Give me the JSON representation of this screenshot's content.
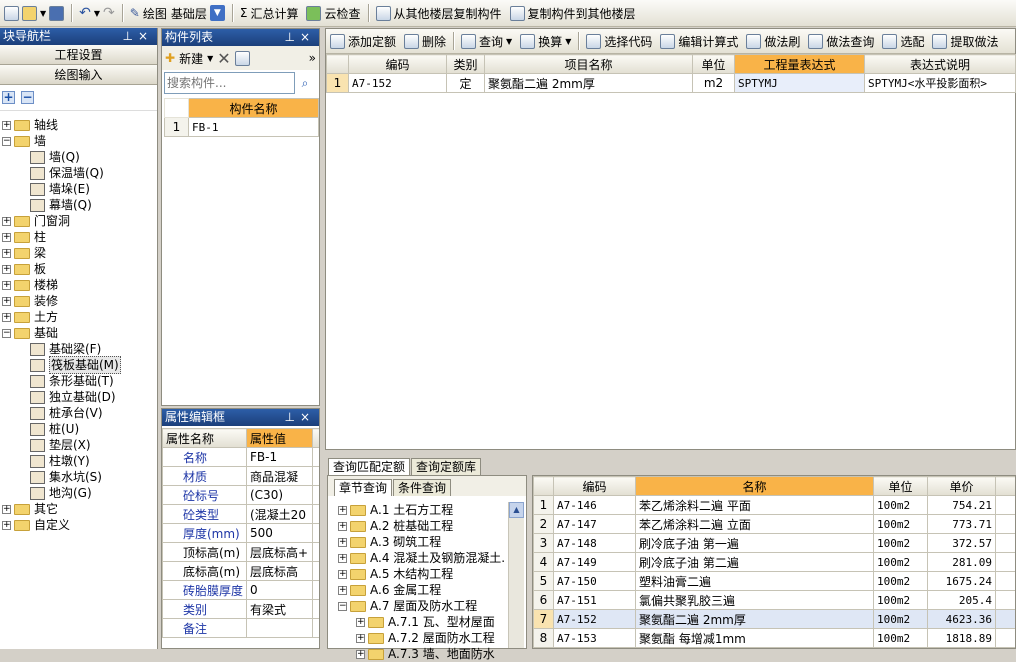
{
  "toolbar": {
    "items": [
      "绘图",
      "基础层",
      "汇总计算",
      "云检查",
      "从其他楼层复制构件",
      "复制构件到其他楼层"
    ]
  },
  "nav": {
    "title": "块导航栏",
    "btn1": "工程设置",
    "btn2": "绘图输入",
    "tree": [
      {
        "label": "轴线",
        "type": "folder",
        "level": 0,
        "pm": "+"
      },
      {
        "label": "墙",
        "type": "folder",
        "level": 0,
        "pm": "-"
      },
      {
        "label": "墙(Q)",
        "type": "item",
        "level": 1
      },
      {
        "label": "保温墙(Q)",
        "type": "item",
        "level": 1
      },
      {
        "label": "墙垛(E)",
        "type": "item",
        "level": 1
      },
      {
        "label": "幕墙(Q)",
        "type": "item",
        "level": 1
      },
      {
        "label": "门窗洞",
        "type": "folder",
        "level": 0,
        "pm": "+"
      },
      {
        "label": "柱",
        "type": "folder",
        "level": 0,
        "pm": "+"
      },
      {
        "label": "梁",
        "type": "folder",
        "level": 0,
        "pm": "+"
      },
      {
        "label": "板",
        "type": "folder",
        "level": 0,
        "pm": "+"
      },
      {
        "label": "楼梯",
        "type": "folder",
        "level": 0,
        "pm": "+"
      },
      {
        "label": "装修",
        "type": "folder",
        "level": 0,
        "pm": "+"
      },
      {
        "label": "土方",
        "type": "folder",
        "level": 0,
        "pm": "+"
      },
      {
        "label": "基础",
        "type": "folder",
        "level": 0,
        "pm": "-"
      },
      {
        "label": "基础梁(F)",
        "type": "item",
        "level": 1
      },
      {
        "label": "筏板基础(M)",
        "type": "item",
        "level": 1,
        "selected": true
      },
      {
        "label": "条形基础(T)",
        "type": "item",
        "level": 1
      },
      {
        "label": "独立基础(D)",
        "type": "item",
        "level": 1
      },
      {
        "label": "桩承台(V)",
        "type": "item",
        "level": 1
      },
      {
        "label": "桩(U)",
        "type": "item",
        "level": 1
      },
      {
        "label": "垫层(X)",
        "type": "item",
        "level": 1
      },
      {
        "label": "柱墩(Y)",
        "type": "item",
        "level": 1
      },
      {
        "label": "集水坑(S)",
        "type": "item",
        "level": 1
      },
      {
        "label": "地沟(G)",
        "type": "item",
        "level": 1
      },
      {
        "label": "其它",
        "type": "folder",
        "level": 0,
        "pm": "+"
      },
      {
        "label": "自定义",
        "type": "folder",
        "level": 0,
        "pm": "+"
      }
    ]
  },
  "comp": {
    "title": "构件列表",
    "new": "新建",
    "search_ph": "搜索构件...",
    "col": "构件名称",
    "rows": [
      {
        "n": "1",
        "name": "FB-1"
      }
    ]
  },
  "prop": {
    "title": "属性编辑框",
    "col1": "属性名称",
    "col2": "属性值",
    "rows": [
      {
        "name": "名称",
        "value": "FB-1",
        "blue": true
      },
      {
        "name": "材质",
        "value": "商品混凝",
        "blue": true
      },
      {
        "name": "砼标号",
        "value": "(C30)",
        "blue": true
      },
      {
        "name": "砼类型",
        "value": "(混凝土20",
        "blue": true
      },
      {
        "name": "厚度(mm)",
        "value": "500",
        "blue": true
      },
      {
        "name": "顶标高(m)",
        "value": "层底标高+",
        "blue": false
      },
      {
        "name": "底标高(m)",
        "value": "层底标高",
        "blue": false
      },
      {
        "name": "砖胎膜厚度",
        "value": "0",
        "blue": true
      },
      {
        "name": "类别",
        "value": "有梁式",
        "blue": true
      },
      {
        "name": "备注",
        "value": "",
        "blue": true
      }
    ]
  },
  "quota": {
    "tools": [
      "添加定额",
      "删除",
      "查询",
      "换算",
      "选择代码",
      "编辑计算式",
      "做法刷",
      "做法查询",
      "选配",
      "提取做法"
    ],
    "headers": [
      "编码",
      "类别",
      "项目名称",
      "单位",
      "工程量表达式",
      "表达式说明"
    ],
    "rows": [
      {
        "n": "1",
        "code": "A7-152",
        "cat": "定",
        "name": "聚氨酯二遍 2mm厚",
        "unit": "m2",
        "expr": "SPTYMJ",
        "desc": "SPTYMJ<水平投影面积>"
      }
    ]
  },
  "bottom": {
    "tabs": [
      "查询匹配定额",
      "查询定额库"
    ],
    "subtabs": [
      "章节查询",
      "条件查询"
    ],
    "tree": [
      {
        "label": "A.1 土石方工程",
        "level": 0,
        "pm": "+"
      },
      {
        "label": "A.2 桩基础工程",
        "level": 0,
        "pm": "+"
      },
      {
        "label": "A.3 砌筑工程",
        "level": 0,
        "pm": "+"
      },
      {
        "label": "A.4 混凝土及钢筋混凝土.",
        "level": 0,
        "pm": "+"
      },
      {
        "label": "A.5 木结构工程",
        "level": 0,
        "pm": "+"
      },
      {
        "label": "A.6 金属工程",
        "level": 0,
        "pm": "+"
      },
      {
        "label": "A.7 屋面及防水工程",
        "level": 0,
        "pm": "-"
      },
      {
        "label": "A.7.1 瓦、型材屋面",
        "level": 1,
        "pm": "+"
      },
      {
        "label": "A.7.2 屋面防水工程",
        "level": 1,
        "pm": "+"
      },
      {
        "label": "A.7.3 墙、地面防水",
        "level": 1,
        "pm": "+"
      }
    ],
    "headers": [
      "编码",
      "名称",
      "单位",
      "单价"
    ],
    "rows": [
      {
        "n": "1",
        "code": "A7-146",
        "name": "苯乙烯涂料二遍 平面",
        "unit": "100m2",
        "price": "754.21"
      },
      {
        "n": "2",
        "code": "A7-147",
        "name": "苯乙烯涂料二遍 立面",
        "unit": "100m2",
        "price": "773.71"
      },
      {
        "n": "3",
        "code": "A7-148",
        "name": "刷冷底子油 第一遍",
        "unit": "100m2",
        "price": "372.57"
      },
      {
        "n": "4",
        "code": "A7-149",
        "name": "刷冷底子油 第二遍",
        "unit": "100m2",
        "price": "281.09"
      },
      {
        "n": "5",
        "code": "A7-150",
        "name": "塑料油膏二遍",
        "unit": "100m2",
        "price": "1675.24"
      },
      {
        "n": "6",
        "code": "A7-151",
        "name": "氯偏共聚乳胶三遍",
        "unit": "100m2",
        "price": "205.4"
      },
      {
        "n": "7",
        "code": "A7-152",
        "name": "聚氨酯二遍 2mm厚",
        "unit": "100m2",
        "price": "4623.36",
        "selected": true
      },
      {
        "n": "8",
        "code": "A7-153",
        "name": "聚氨酯 每增减1mm",
        "unit": "100m2",
        "price": "1818.89"
      }
    ]
  }
}
